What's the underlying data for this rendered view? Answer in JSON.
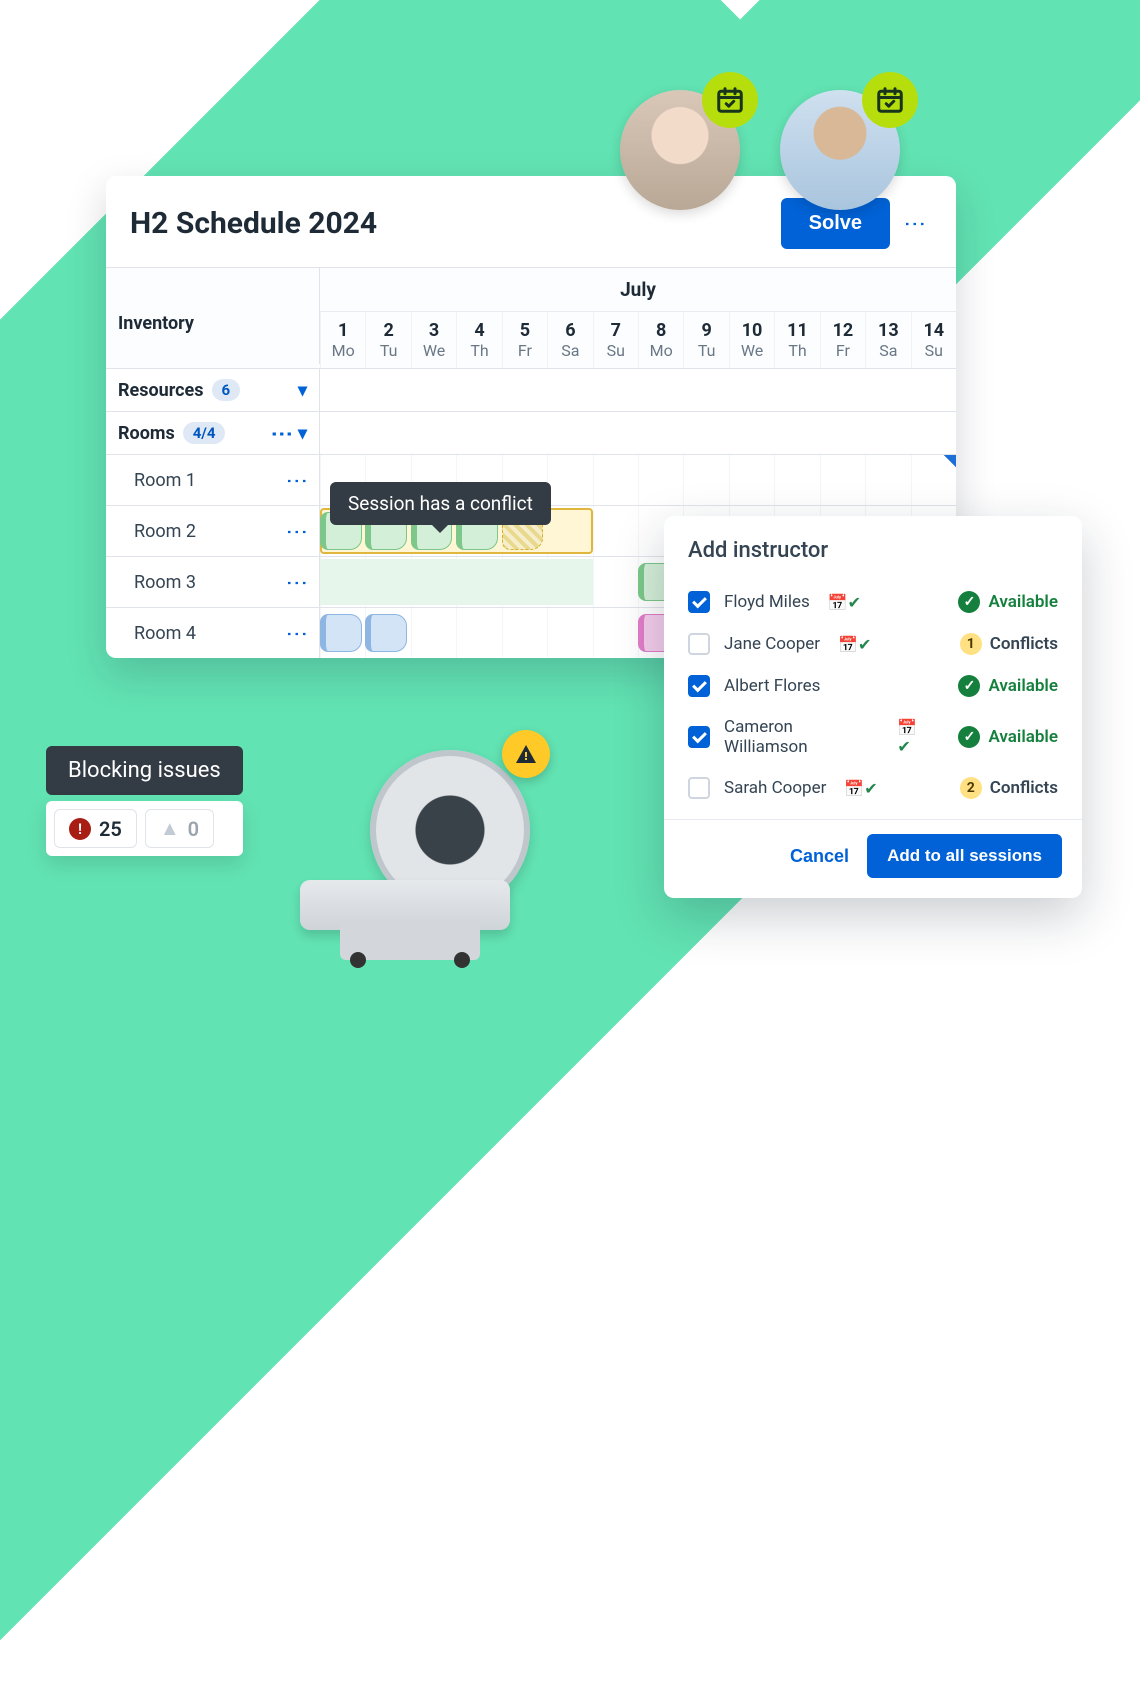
{
  "header": {
    "title": "H2 Schedule 2024",
    "solve_label": "Solve"
  },
  "month_label": "July",
  "inventory_label": "Inventory",
  "days": [
    {
      "num": "1",
      "dow": "Mo"
    },
    {
      "num": "2",
      "dow": "Tu"
    },
    {
      "num": "3",
      "dow": "We"
    },
    {
      "num": "4",
      "dow": "Th"
    },
    {
      "num": "5",
      "dow": "Fr"
    },
    {
      "num": "6",
      "dow": "Sa"
    },
    {
      "num": "7",
      "dow": "Su"
    },
    {
      "num": "8",
      "dow": "Mo"
    },
    {
      "num": "9",
      "dow": "Tu"
    },
    {
      "num": "10",
      "dow": "We"
    },
    {
      "num": "11",
      "dow": "Th"
    },
    {
      "num": "12",
      "dow": "Fr"
    },
    {
      "num": "13",
      "dow": "Sa"
    },
    {
      "num": "14",
      "dow": "Su"
    }
  ],
  "groups": {
    "resources": {
      "label": "Resources",
      "count": "6"
    },
    "rooms": {
      "label": "Rooms",
      "count": "4/4"
    }
  },
  "rooms": {
    "r1": "Room 1",
    "r2": "Room 2",
    "r3": "Room 3",
    "r4": "Room 4"
  },
  "tooltip_conflict": "Session has a conflict",
  "blocking": {
    "label": "Blocking issues",
    "errors": "25",
    "warnings": "0"
  },
  "dialog": {
    "title": "Add instructor",
    "people": [
      {
        "name": "Floyd Miles",
        "checked": true,
        "cal": true,
        "status": "Available",
        "ok": true
      },
      {
        "name": "Jane Cooper",
        "checked": false,
        "cal": true,
        "status": "Conflicts",
        "ok": false,
        "n": "1"
      },
      {
        "name": "Albert Flores",
        "checked": true,
        "cal": false,
        "status": "Available",
        "ok": true
      },
      {
        "name": "Cameron Williamson",
        "checked": true,
        "cal": true,
        "status": "Available",
        "ok": true
      },
      {
        "name": "Sarah Cooper",
        "checked": false,
        "cal": true,
        "status": "Conflicts",
        "ok": false,
        "n": "2"
      }
    ],
    "cancel": "Cancel",
    "submit": "Add to all sessions"
  }
}
